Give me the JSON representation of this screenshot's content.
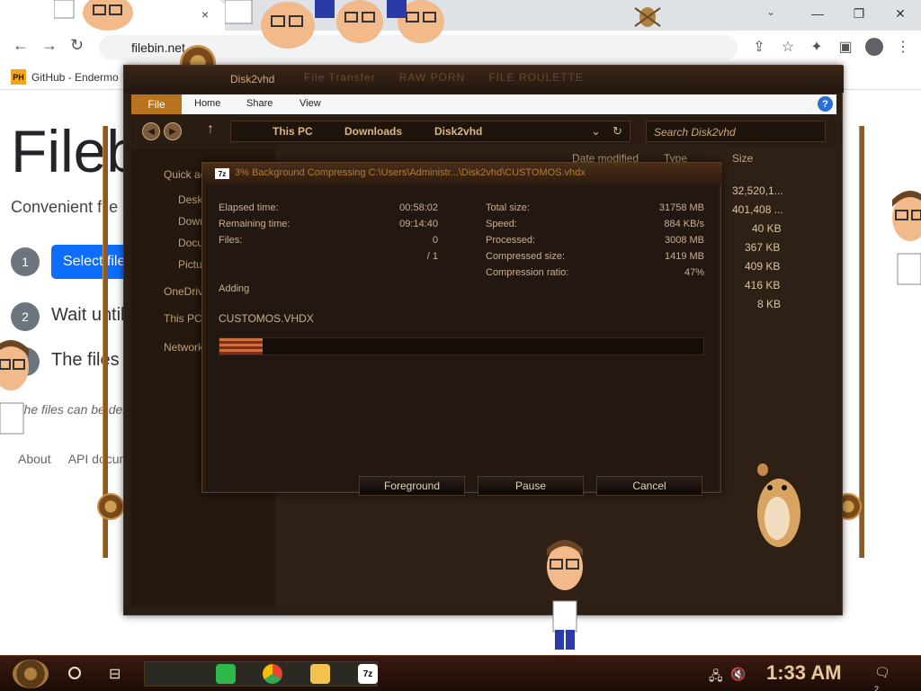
{
  "browser": {
    "tab_close": "×",
    "window_controls": {
      "minimize": "—",
      "maximize": "❐",
      "close": "✕"
    },
    "url": "filebin.net",
    "bookmark": {
      "badge": "PH",
      "label": "GitHub - Endermo"
    }
  },
  "filebin": {
    "title": "Filebin",
    "subtitle": "Convenient file sharing in the browser",
    "step1_num": "1",
    "select_button": "Select files to upload",
    "step2_num": "2",
    "step2_text": "Wait until the upload is complete",
    "step3_num": "3",
    "step3_text": "The files will be available at the URL that you can share",
    "note": "The files can be deleted manually",
    "links": [
      "About",
      "API documentation"
    ]
  },
  "explorer": {
    "title": "Disk2vhd",
    "ghost_tabs": [
      "File Transfer",
      "RAW PORN",
      "FILE ROULETTE"
    ],
    "ribbon": {
      "file": "File",
      "home": "Home",
      "share": "Share",
      "view": "View"
    },
    "breadcrumbs": [
      "This PC",
      "Downloads",
      "Disk2vhd"
    ],
    "search_placeholder": "Search Disk2vhd",
    "nav_items": [
      "Quick access",
      "Desktop",
      "Downloads",
      "Documents",
      "Pictures",
      "OneDrive",
      "This PC",
      "Network"
    ],
    "columns": {
      "date_modified": "Date modified",
      "type": "Type",
      "size": "Size"
    },
    "sizes": [
      "32,520,1...",
      "401,408 ...",
      "40 KB",
      "367 KB",
      "409 KB",
      "416 KB",
      "8 KB"
    ]
  },
  "dialog": {
    "icon_text": "7z",
    "title": "3% Background Compressing C:\\Users\\Administr...\\Disk2vhd\\CUSTOMOS.vhdx",
    "elapsed_label": "Elapsed time:",
    "elapsed_value": "00:58:02",
    "remaining_label": "Remaining time:",
    "remaining_value": "09:14:40",
    "files_label": "Files:",
    "files_value": "0",
    "files_total": "/ 1",
    "total_size_label": "Total size:",
    "total_size_value": "31758 MB",
    "speed_label": "Speed:",
    "speed_value": "884 KB/s",
    "processed_label": "Processed:",
    "processed_value": "3008 MB",
    "compressed_label": "Compressed size:",
    "compressed_value": "1419 MB",
    "ratio_label": "Compression ratio:",
    "ratio_value": "47%",
    "status": "Adding",
    "filename": "CUSTOMOS.VHDX",
    "progress_percent": 9,
    "buttons": {
      "foreground": "Foreground",
      "pause": "Pause",
      "cancel": "Cancel"
    }
  },
  "taskbar": {
    "clock": "1:33 AM",
    "notification_count": "2"
  }
}
